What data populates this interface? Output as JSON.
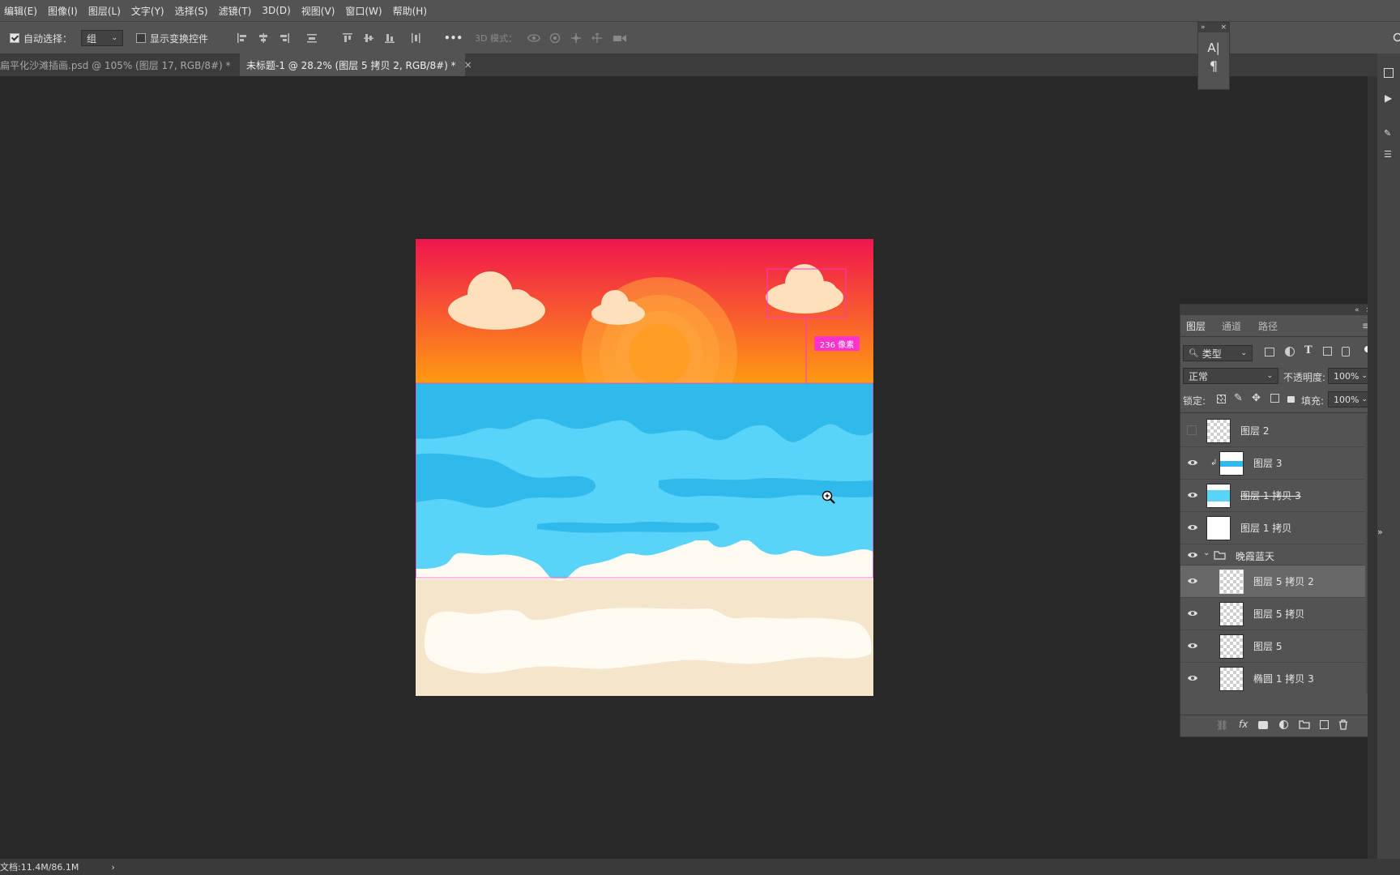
{
  "menu": [
    "编辑(E)",
    "图像(I)",
    "图层(L)",
    "文字(Y)",
    "选择(S)",
    "滤镜(T)",
    "3D(D)",
    "视图(V)",
    "窗口(W)",
    "帮助(H)"
  ],
  "options": {
    "auto_select_label": "自动选择：",
    "auto_select_value": "组",
    "show_transform_label": "显示变换控件",
    "more_label": "•••",
    "mode3d_label": "3D 模式："
  },
  "tabs": [
    {
      "title": "扁平化沙滩插画.psd @ 105% (图层 17, RGB/8#) *",
      "close": "×"
    },
    {
      "title": "未标题-1 @ 28.2% (图层 5 拷贝 2, RGB/8#) *",
      "close": "×"
    }
  ],
  "char_panel": {
    "char_icon": "A|",
    "para_icon": "¶"
  },
  "canvas": {
    "distance_label": "236 像素",
    "colors": {
      "sky_top": "#f0154e",
      "sky_bottom": "#ff9a12",
      "sea": "#59d3f8",
      "sea_dark": "#2fbaeb",
      "sand": "#f4e5cb",
      "foam": "#fffaf2",
      "cloud": "#ffe0bd",
      "sun": "#ff9d24",
      "guide": "#ff33cc"
    }
  },
  "layers_panel": {
    "tabs": [
      "图层",
      "通道",
      "路径"
    ],
    "filter_label": "类型",
    "blend_mode": "正常",
    "opacity_label": "不透明度:",
    "opacity_value": "100%",
    "lock_label": "锁定:",
    "fill_label": "填充:",
    "fill_value": "100%",
    "layers": [
      {
        "name": "图层 2",
        "visible": false
      },
      {
        "name": "图层 3",
        "visible": true
      },
      {
        "name": "图层 1 拷贝 3",
        "visible": true
      },
      {
        "name": "图层 1 拷贝",
        "visible": true
      },
      {
        "name": "晚霞蓝天",
        "visible": true,
        "group": true
      },
      {
        "name": "图层 5 拷贝 2",
        "visible": true,
        "selected": true
      },
      {
        "name": "图层 5 拷贝",
        "visible": true
      },
      {
        "name": "图层 5",
        "visible": true
      },
      {
        "name": "椭圆 1 拷贝 3",
        "visible": true
      }
    ]
  },
  "status": {
    "doc": "文档:11.4M/86.1M",
    "arrow": "›"
  }
}
